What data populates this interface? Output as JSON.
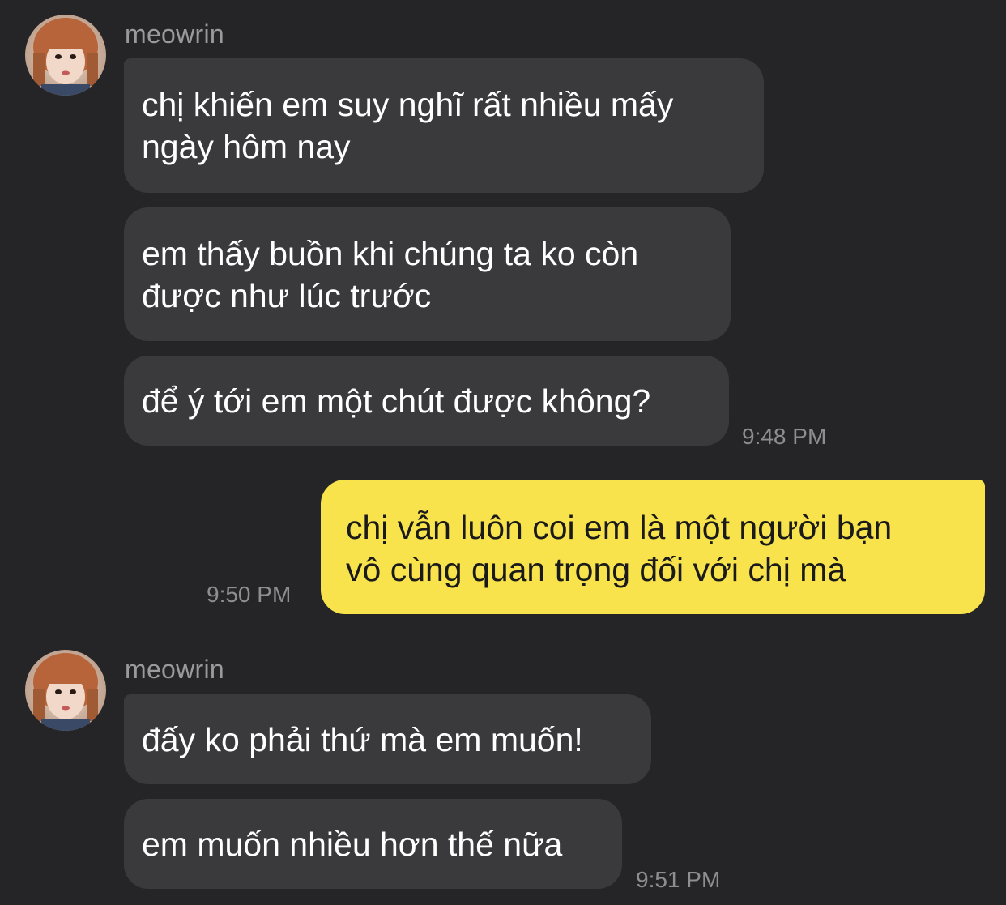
{
  "theme": {
    "background": "#252527",
    "incoming_bubble": "#3a3a3d",
    "outgoing_bubble": "#f8e34c",
    "incoming_text": "#ffffff",
    "outgoing_text": "#1a1a1a",
    "meta_text": "#8e8e92"
  },
  "groups": [
    {
      "sender": "meowrin",
      "avatar_icon": "profile-photo-avatar",
      "messages": [
        {
          "lines": [
            "chị khiến em suy nghĩ rất nhiều mấy",
            "ngày hôm nay"
          ]
        },
        {
          "lines": [
            "em thấy buồn khi chúng ta ko còn",
            "được như lúc trước"
          ]
        },
        {
          "lines": [
            "để ý tới em một chút được không?"
          ]
        }
      ],
      "time": "9:48 PM"
    },
    {
      "sender": "me",
      "messages": [
        {
          "lines": [
            "chị vẫn luôn coi em là một người bạn",
            "vô cùng quan trọng đối với chị mà"
          ]
        }
      ],
      "time": "9:50 PM"
    },
    {
      "sender": "meowrin",
      "avatar_icon": "profile-photo-avatar",
      "messages": [
        {
          "lines": [
            "đấy ko phải thứ mà em muốn!"
          ]
        },
        {
          "lines": [
            "em muốn nhiều hơn thế nữa"
          ]
        }
      ],
      "time": "9:51 PM"
    }
  ]
}
